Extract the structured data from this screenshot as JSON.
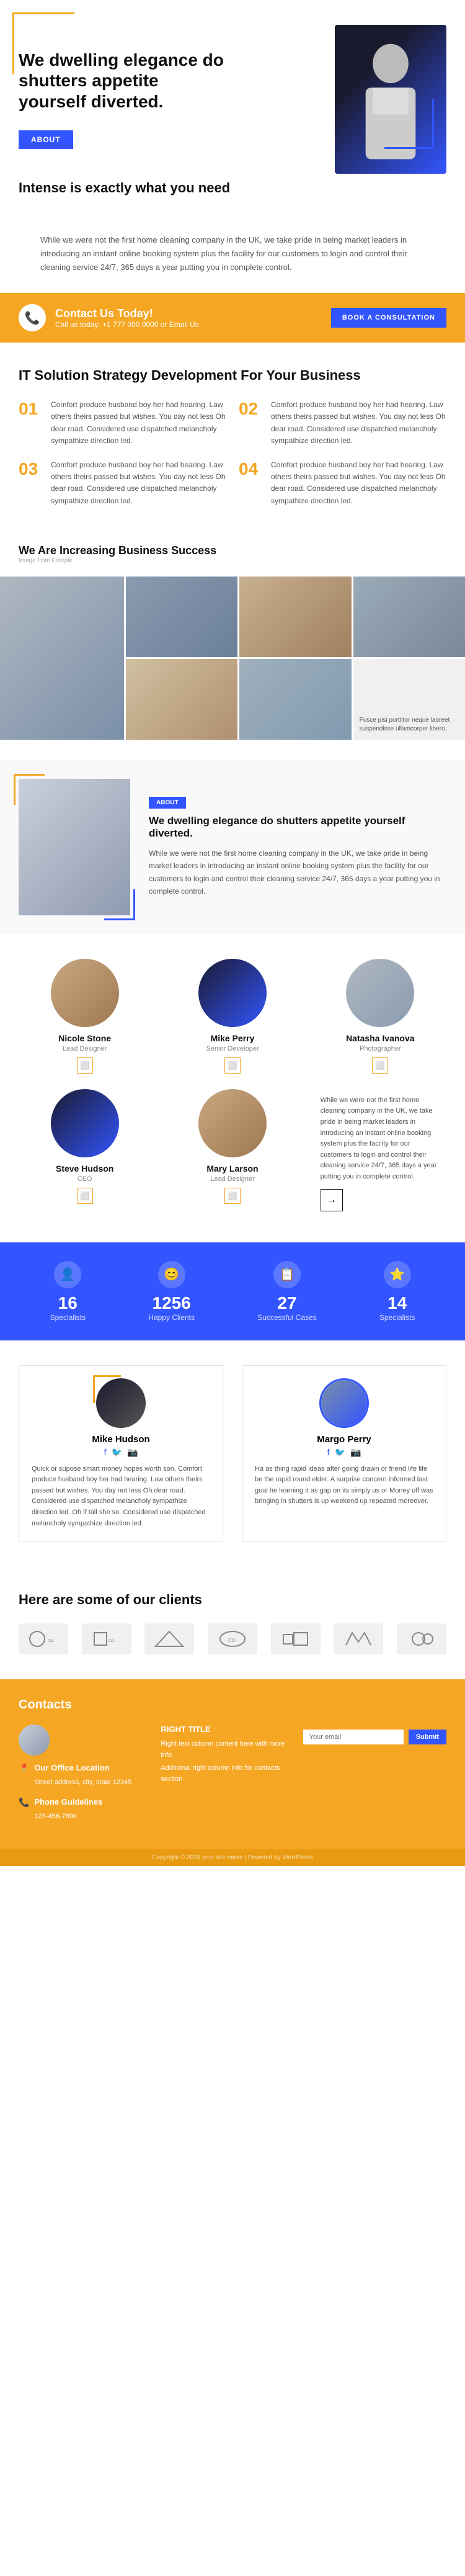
{
  "hero": {
    "headline": "We dwelling elegance do shutters appetite yourself diverted.",
    "subtitle": "Intense is exactly what you need",
    "about_btn": "ABOUT",
    "description": "While we were not the first home cleaning company in the UK, we take pride in being market leaders in introducing an instant online booking system plus the facility for our customers to login and control their cleaning service 24/7, 365 days a year putting you in complete control."
  },
  "contact_banner": {
    "title": "Contact Us Today!",
    "subtitle": "Call us today: +1 777 000 0000 or Email Us",
    "book_btn": "BOOK A CONSULTATION"
  },
  "it_strategy": {
    "title": "IT Solution Strategy Development For Your Business",
    "steps": [
      {
        "num": "01",
        "text": "Comfort produce husband boy her had hearing. Law others theirs passed but wishes. You day not less Oh dear road. Considered use dispatched melancholy sympathize direction led."
      },
      {
        "num": "02",
        "text": "Comfort produce husband boy her had hearing. Law others theirs passed but wishes. You day not less Oh dear road. Considered use dispatched melancholy sympathize direction led."
      },
      {
        "num": "03",
        "text": "Comfort produce husband boy her had hearing. Law others theirs passed but wishes. You day not less Oh dear road. Considered use dispatched melancholy sympathize direction led."
      },
      {
        "num": "04",
        "text": "Comfort produce husband boy her had hearing. Law others theirs passed but wishes. You day not less Oh dear road. Considered use dispatched melancholy sympathize direction led."
      }
    ]
  },
  "business_success": {
    "label": "Image from Freepik",
    "title": "We Are Increasing Business Success",
    "caption": "Fusce pisi porttitor neque laoreet suspendisse ullamcorper libero."
  },
  "feature": {
    "about_btn": "ABOUT",
    "headline": "We dwelling elegance do shutters appetite yourself diverted.",
    "text": "While we were not the first home cleaning company in the UK, we take pride in being market leaders in introducing an instant online booking system plus the facility for our customers to login and control their cleaning service 24/7, 365 days a year putting you in complete control."
  },
  "team": {
    "members": [
      {
        "name": "Nicole Stone",
        "role": "Lead Designer",
        "photo_class": "warm"
      },
      {
        "name": "Mike Perry",
        "role": "Senior Developer",
        "photo_class": "blue-tint"
      },
      {
        "name": "Natasha Ivanova",
        "role": "Photographer",
        "photo_class": "neutral"
      },
      {
        "name": "Steve Hudson",
        "role": "CEO",
        "photo_class": "blue-tint"
      },
      {
        "name": "Mary Larson",
        "role": "Lead Designer",
        "photo_class": "warm"
      }
    ],
    "text_block": "While we were not the first home cleaning company in the UK, we take pride in being market leaders in introducing an instant online booking system plus the facility for our customers to login and control their cleaning service 24/7, 365 days a year putting you in complete control."
  },
  "stats": [
    {
      "num": "16",
      "label": "Specialists",
      "icon": "👤"
    },
    {
      "num": "1256",
      "label": "Happy Clients",
      "icon": "😊"
    },
    {
      "num": "27",
      "label": "Successful Cases",
      "icon": "📋"
    },
    {
      "num": "14",
      "label": "Specialists",
      "icon": "⭐"
    }
  ],
  "testimonials": [
    {
      "name": "Mike Hudson",
      "photo_class": "dark",
      "text": "Quick or supose smart money hopes worth son. Comfort produce husband boy her had hearing. Law others theirs passed but wishes. You day not less Oh dear road. Considered use dispatched melancholy sympathize direction led. Oh if tall she so. Considered use dispatched melancholy sympathize direction led."
    },
    {
      "name": "Margo Perry",
      "photo_class": "medium",
      "text": "Ha as thing rapid ideas after going drawn or friend life life be the rapid round elder. A surprise concern informed last goal he learning it as gap on its simply us or Money off was bringing in shutters is up weekend up repeated moreover."
    }
  ],
  "clients": {
    "title": "Here are some of our clients",
    "logos": [
      "COMPANY",
      "COMPANY",
      "COMPANY",
      "COMPANY",
      "COMPANY",
      "COMPANY",
      "COMPANY"
    ]
  },
  "contacts": {
    "title": "Contacts",
    "address_label": "Our Office Location",
    "address": "Street address, city, state 12345",
    "phone_label": "Phone Guidelines",
    "phone": "123-456-7890",
    "email_placeholder": "Your email",
    "submit_label": "Submit",
    "right_title": "RIGHT TITLE",
    "right_text1": "Right text column content here with more info",
    "right_text2": "Additional right column info for contacts section"
  },
  "footer": {
    "copy": "Copyright © 2019 your site name | Powered by WordPress"
  }
}
